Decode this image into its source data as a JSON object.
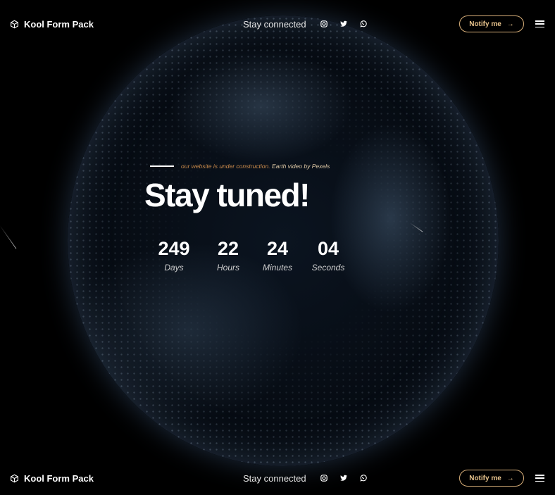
{
  "header": {
    "brand": "Kool Form Pack",
    "nav_text": "Stay connected",
    "social_icons": [
      "instagram-icon",
      "twitter-icon",
      "whatsapp-icon"
    ],
    "notify_label": "Notify me",
    "accent_color": "#d9b07a"
  },
  "hero": {
    "construction_note": "our website is under construction.",
    "credit": "Earth video by Pexels",
    "title": "Stay tuned!"
  },
  "countdown": [
    {
      "value": "249",
      "label": "Days"
    },
    {
      "value": "22",
      "label": "Hours"
    },
    {
      "value": "24",
      "label": "Minutes"
    },
    {
      "value": "04",
      "label": "Seconds"
    }
  ],
  "footer_header": {
    "brand": "Kool Form Pack",
    "nav_text": "Stay connected",
    "notify_label": "Notify me"
  }
}
